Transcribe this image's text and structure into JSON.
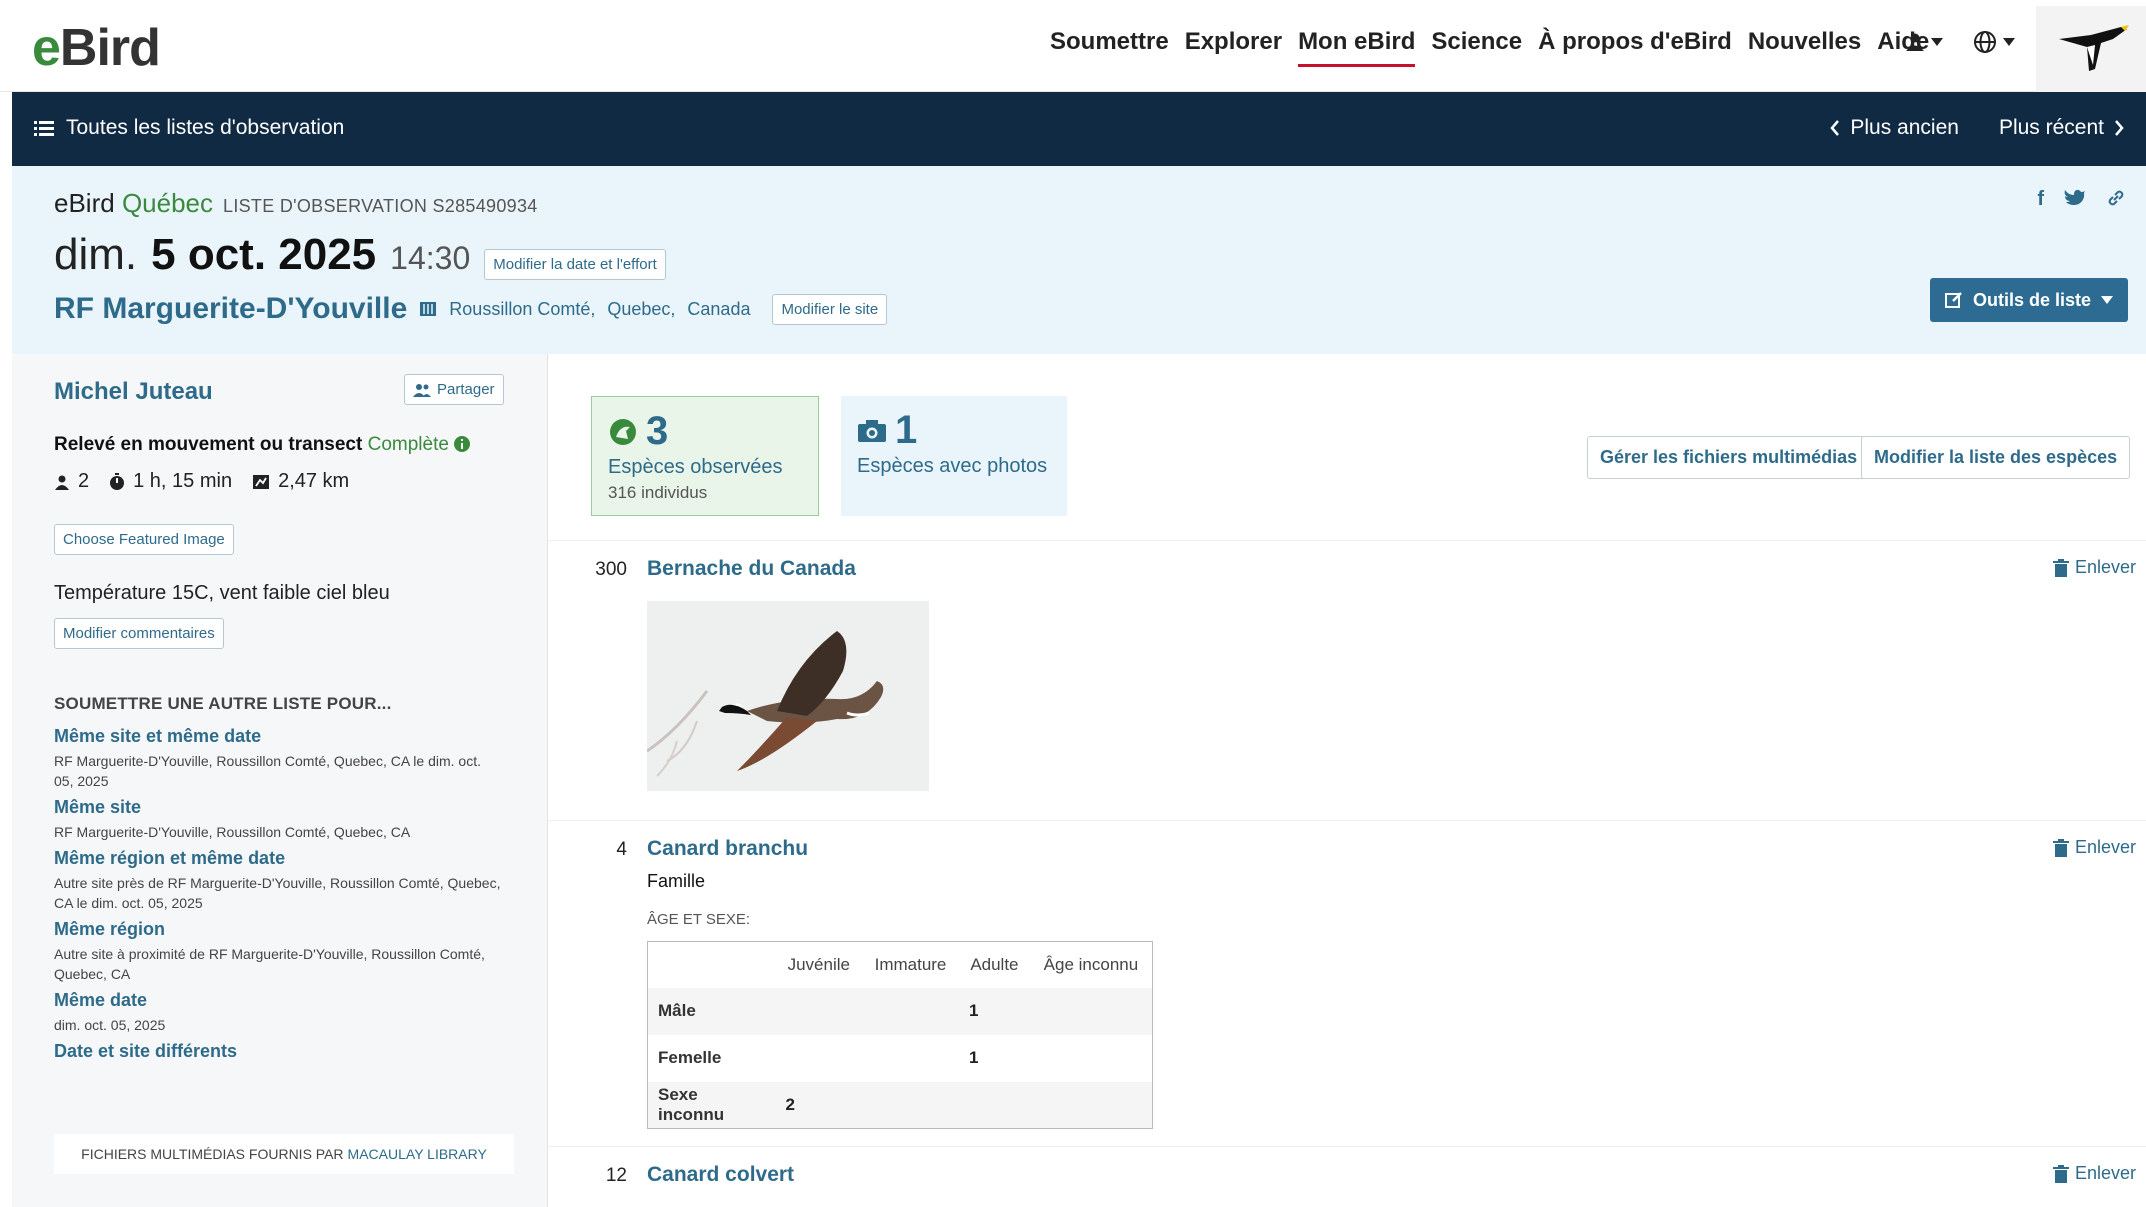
{
  "topnav": {
    "logo_e": "e",
    "logo_rest": "Bird",
    "items": [
      "Soumettre",
      "Explorer",
      "Mon eBird",
      "Science",
      "À propos d'eBird",
      "Nouvelles",
      "Aide"
    ],
    "active_index": 2
  },
  "subbar": {
    "all_lists": "Toutes les listes d'observation",
    "older": "Plus ancien",
    "newer": "Plus récent"
  },
  "header": {
    "portal_ebird": "eBird",
    "portal_region": "Québec",
    "checklist_id": "LISTE D'OBSERVATION S285490934",
    "day": "dim.",
    "date": "5 oct. 2025",
    "time": "14:30",
    "edit_date_btn": "Modifier la date et l'effort",
    "site_name": "RF Marguerite-D'Youville",
    "loc_county": "Roussillon Comté,",
    "loc_province": "Quebec,",
    "loc_country": "Canada",
    "edit_site_btn": "Modifier le site",
    "tools_btn": "Outils de liste"
  },
  "sidebar": {
    "observer": "Michel Juteau",
    "share_btn": "Partager",
    "protocol": "Relevé en mouvement ou transect",
    "complete": "Complète",
    "observers": "2",
    "duration": "1 h, 15 min",
    "distance": "2,47 km",
    "featured_btn": "Choose Featured Image",
    "comment": "Température 15C, vent faible ciel bleu",
    "edit_comments_btn": "Modifier commentaires",
    "submit_title": "SOUMETTRE UNE AUTRE LISTE POUR...",
    "submit_options": [
      {
        "label": "Même site et même date",
        "desc": "RF Marguerite-D'Youville, Roussillon Comté, Quebec, CA le dim. oct. 05, 2025"
      },
      {
        "label": "Même site",
        "desc": "RF Marguerite-D'Youville, Roussillon Comté, Quebec, CA"
      },
      {
        "label": "Même région et même date",
        "desc": "Autre site près de RF Marguerite-D'Youville, Roussillon Comté, Quebec, CA le dim. oct. 05, 2025"
      },
      {
        "label": "Même région",
        "desc": "Autre site à proximité de RF Marguerite-D'Youville, Roussillon Comté, Quebec, CA"
      },
      {
        "label": "Même date",
        "desc": "dim. oct. 05, 2025"
      },
      {
        "label": "Date et site différents",
        "desc": ""
      }
    ],
    "macaulay_prefix": "FICHIERS MULTIMÉDIAS FOURNIS PAR",
    "macaulay_link": "MACAULAY LIBRARY"
  },
  "summary": {
    "species_count": "3",
    "species_label": "Espèces observées",
    "individuals": "316 individus",
    "photo_count": "1",
    "photo_label": "Espèces avec photos",
    "manage_media_btn": "Gérer les fichiers multimédias",
    "modify_species_btn": "Modifier la liste des espèces"
  },
  "observations": [
    {
      "count": "300",
      "name": "Bernache du Canada",
      "remove": "Enlever"
    },
    {
      "count": "4",
      "name": "Canard branchu",
      "remove": "Enlever",
      "note": "Famille",
      "agesex_label": "ÂGE ET SEXE:"
    },
    {
      "count": "12",
      "name": "Canard colvert",
      "remove": "Enlever"
    }
  ],
  "agesex": {
    "columns": [
      "Juvénile",
      "Immature",
      "Adulte",
      "Âge inconnu"
    ],
    "rows": [
      {
        "label": "Mâle",
        "values": [
          "",
          "",
          "1",
          ""
        ]
      },
      {
        "label": "Femelle",
        "values": [
          "",
          "",
          "1",
          ""
        ]
      },
      {
        "label": "Sexe inconnu",
        "values": [
          "2",
          "",
          "",
          ""
        ]
      }
    ]
  },
  "colors": {
    "accent": "#2e6b8a",
    "green": "#3a8a3e",
    "navbar": "#102a43",
    "active_underline": "#c8102e"
  }
}
